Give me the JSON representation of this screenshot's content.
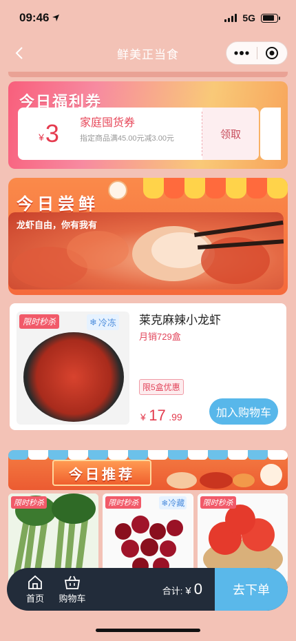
{
  "status": {
    "time": "09:46",
    "network": "5G",
    "battery_level": 0.8
  },
  "nav": {
    "title": "鲜美正当食"
  },
  "coupon": {
    "section_title": "今日福利券",
    "currency": "¥",
    "amount": "3",
    "name": "家庭囤货券",
    "condition": "指定商品满45.00元减3.00元",
    "claim_label": "领取"
  },
  "taste": {
    "title": "今日尝鲜",
    "subtitle": "龙虾自由，你有我有"
  },
  "product": {
    "flash_label": "限时秒杀",
    "frozen_label": "冷冻",
    "name": "莱克麻辣小龙虾",
    "sales": "月销729盒",
    "limit_label": "限5盒优惠",
    "price_currency": "¥",
    "price_int": "17",
    "price_dec": ".99",
    "add_cart_label": "加入购物车"
  },
  "recommend": {
    "title": "今日推荐",
    "items": [
      {
        "flash_label": "限时秒杀"
      },
      {
        "flash_label": "限时秒杀",
        "frozen_label": "冷藏"
      },
      {
        "flash_label": "限时秒杀"
      }
    ]
  },
  "bottom_bar": {
    "home_label": "首页",
    "cart_label": "购物车",
    "total_label": "合计:",
    "total_currency": "¥",
    "total_value": "0",
    "checkout_label": "去下单"
  },
  "colors": {
    "accent_blue": "#58b7ea",
    "price_red": "#e33b4d",
    "bar_dark": "#222c3a"
  }
}
